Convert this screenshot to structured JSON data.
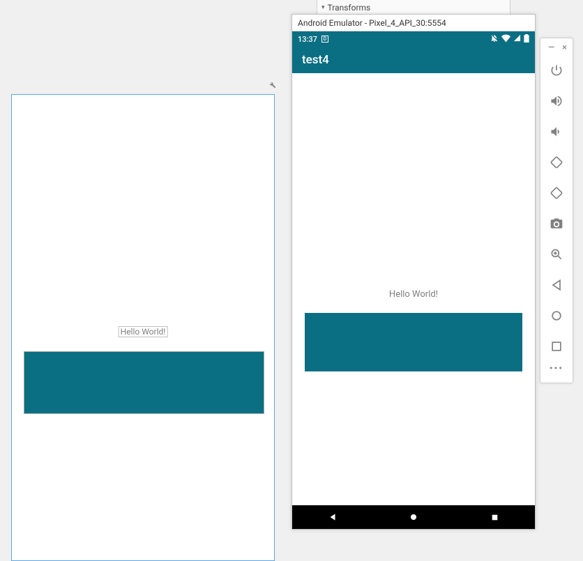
{
  "transforms": {
    "label": "Transforms"
  },
  "preview": {
    "textview": "Hello World!"
  },
  "emulator": {
    "title": "Android Emulator - Pixel_4_API_30:5554",
    "statusbar": {
      "time": "13:37"
    },
    "appbar": {
      "title": "test4"
    },
    "content": {
      "hello": "Hello World!"
    }
  },
  "toolbar": {
    "more": "•••"
  }
}
